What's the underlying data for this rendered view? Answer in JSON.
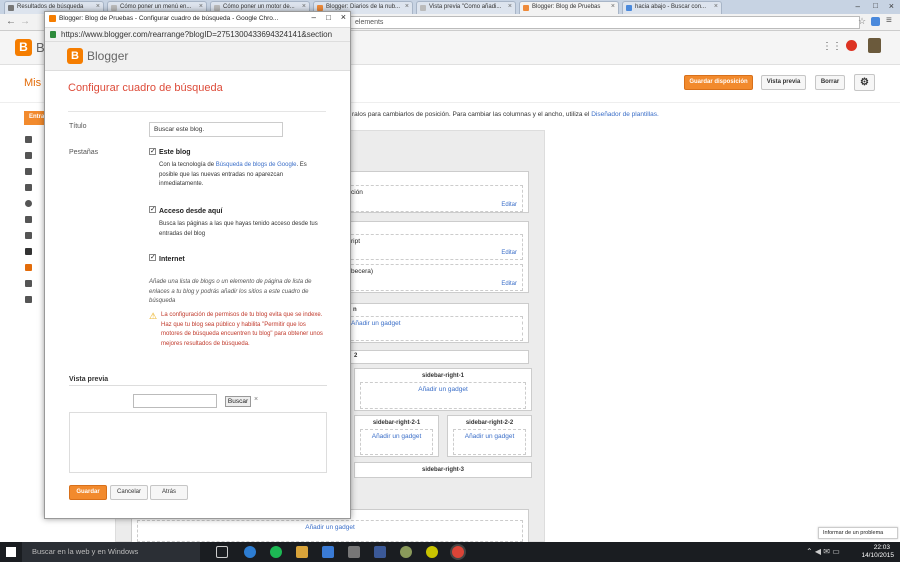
{
  "browser": {
    "tabs": [
      {
        "title": "Resultados de búsqueda"
      },
      {
        "title": "Cómo poner un menú en..."
      },
      {
        "title": "Cómo poner un motor de..."
      },
      {
        "title": "Blogger: Diarios de la nub..."
      },
      {
        "title": "Vista previa \"Como añadi..."
      },
      {
        "title": "Blogger: Blog de Pruebas"
      },
      {
        "title": "hacia abajo - Buscar con..."
      }
    ],
    "address_tail": "elements"
  },
  "blogger_page": {
    "logo_text": "Blogger",
    "blog_short": "Mis",
    "buttons": {
      "save": "Guardar disposición",
      "preview": "Vista previa",
      "clear": "Borrar"
    },
    "info_text": "ralos para cambiarlos de posición. Para cambiar las columnas y el ancho, utiliza el",
    "info_link": "Diseñador de plantillas.",
    "edit_label": "Editar",
    "boxes": {
      "b1": "ción",
      "b2": "ript",
      "b3": "becera)",
      "b4": "n",
      "section2": "2",
      "sr1": "sidebar-right-1",
      "sr21": "sidebar-right-2-1",
      "sr22": "sidebar-right-2-2",
      "sr3": "sidebar-right-3",
      "add_gadget": "Añadir un gadget"
    },
    "nav_orange": "Entra",
    "report_problem": "Informar de un problema"
  },
  "popup": {
    "window_title": "Blogger: Blog de Pruebas - Configurar cuadro de búsqueda - Google Chro...",
    "url": "https://www.blogger.com/rearrange?blogID=2751300433694324141&section",
    "logo_text": "Blogger",
    "heading": "Configurar cuadro de búsqueda",
    "title_label": "Título",
    "title_value": "Buscar este blog.",
    "tabs_label": "Pestañas",
    "opt1_label": "Este blog",
    "opt1_desc_pre": "Con la tecnología de ",
    "opt1_desc_link": "Búsqueda de blogs de Google",
    "opt1_desc_post": ". Es posible que las nuevas entradas no aparezcan inmediatamente.",
    "opt2_label": "Acceso desde aquí",
    "opt2_desc": "Busca las páginas a las que hayas tenido acceso desde tus entradas del blog",
    "opt3_label": "Internet",
    "hint": "Añade una lista de blogs o un elemento de página de lista de enlaces a tu blog y podrás añadir los sitios a este cuadro de búsqueda",
    "warning": "La configuración de permisos de tu blog evita que se indexe. Haz que tu blog sea público y habilita \"Permitir que los motores de búsqueda encuentren tu blog\" para obtener unos mejores resultados de búsqueda.",
    "preview_label": "Vista previa",
    "search_button": "Buscar",
    "save": "Guardar",
    "cancel": "Cancelar",
    "back": "Atrás"
  },
  "taskbar": {
    "search_placeholder": "Buscar en la web y en Windows",
    "time": "22:03",
    "date": "14/10/2015"
  }
}
